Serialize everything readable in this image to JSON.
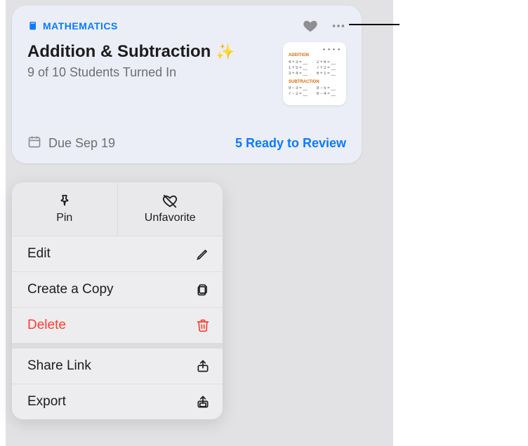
{
  "card": {
    "subject_label": "MATHEMATICS",
    "title": "Addition & Subtraction",
    "sparkle": "✨",
    "subtitle": "9 of 10 Students Turned In",
    "due_label": "Due Sep 19",
    "review_label": "5 Ready to Review"
  },
  "menu": {
    "top": {
      "pin_label": "Pin",
      "unfavorite_label": "Unfavorite"
    },
    "items": {
      "edit": "Edit",
      "copy": "Create a Copy",
      "delete": "Delete",
      "share": "Share Link",
      "export": "Export"
    }
  },
  "thumb": {
    "h1": "ADDITION",
    "h2": "SUBTRACTION"
  }
}
